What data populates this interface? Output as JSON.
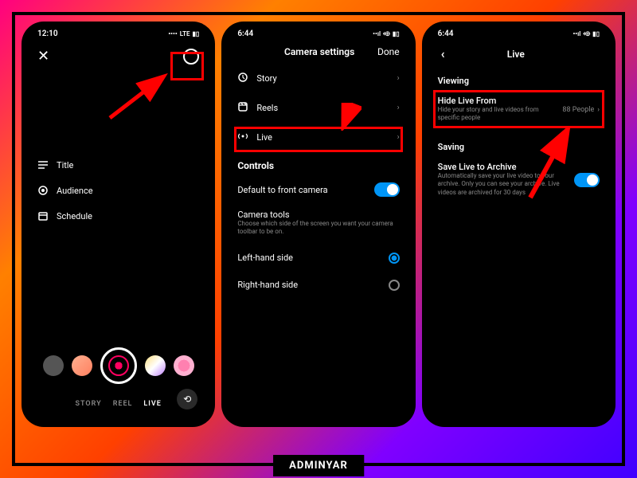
{
  "watermark": "ADMINYAR",
  "phone1": {
    "time": "12:10",
    "network": "LTE",
    "menu": {
      "title": "Title",
      "audience": "Audience",
      "schedule": "Schedule"
    },
    "modes": {
      "story": "STORY",
      "reel": "REEL",
      "live": "LIVE"
    }
  },
  "phone2": {
    "time": "6:44",
    "header_title": "Camera settings",
    "header_done": "Done",
    "items": {
      "story": "Story",
      "reels": "Reels",
      "live": "Live"
    },
    "controls_title": "Controls",
    "default_camera": "Default to front camera",
    "camera_tools_title": "Camera tools",
    "camera_tools_sub": "Choose which side of the screen you want your camera toolbar to be on.",
    "left_hand": "Left-hand side",
    "right_hand": "Right-hand side"
  },
  "phone3": {
    "time": "6:44",
    "header_title": "Live",
    "viewing_section": "Viewing",
    "hide_title": "Hide Live From",
    "hide_sub": "Hide your story and live videos from specific people",
    "hide_count": "88 People",
    "saving_section": "Saving",
    "save_title": "Save Live to Archive",
    "save_sub": "Automatically save your live video to your archive. Only you can see your archive. Live videos are archived for 30 days"
  }
}
